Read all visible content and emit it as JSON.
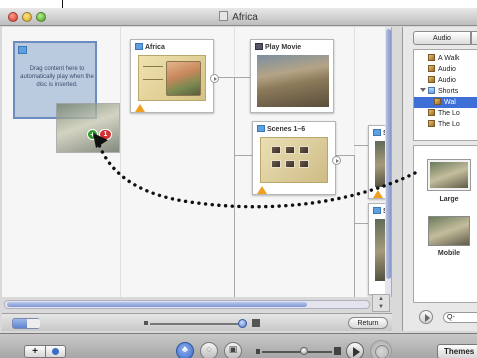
{
  "window": {
    "title": "Africa"
  },
  "canvas": {
    "dropzone_hint": "Drag content here to automatically play when the disc is inserted.",
    "drag_badge_count": "1",
    "nodes": {
      "africa": {
        "title": "Africa"
      },
      "play_movie": {
        "title": "Play Movie"
      },
      "scenes": {
        "title": "Scenes 1–6"
      },
      "side_a": {
        "title": "Sc"
      },
      "side_b": {
        "title": "Sc"
      }
    },
    "return_label": "Return"
  },
  "panel": {
    "tabs": [
      {
        "label": "Audio"
      },
      {
        "label": ""
      }
    ],
    "media": [
      {
        "label": "A Walk",
        "kind": "file"
      },
      {
        "label": "Audio",
        "kind": "file"
      },
      {
        "label": "Audio",
        "kind": "file"
      },
      {
        "label": "Shorts",
        "kind": "folder"
      },
      {
        "label": "Wal",
        "kind": "file",
        "selected": true
      },
      {
        "label": "The Lo",
        "kind": "file"
      },
      {
        "label": "The Lo",
        "kind": "file"
      }
    ],
    "styles": [
      {
        "label": "Large"
      },
      {
        "label": "Mobile"
      }
    ],
    "search_placeholder": "Q-"
  },
  "toolbar": {
    "add_label": "+",
    "themes_label": "Themes"
  },
  "colors": {
    "selection": "#3d6fd6",
    "add_badge": "#2a9a2a",
    "count_badge": "#d63030",
    "scroll_accent": "#7f96d4"
  },
  "icons": [
    "doc-icon",
    "plus-icon",
    "info-icon",
    "play-icon",
    "search-icon",
    "warning-icon",
    "folder-icon",
    "audio-file-icon",
    "zoom-small-icon",
    "zoom-large-icon",
    "volume-low-icon",
    "volume-high-icon",
    "burn-icon"
  ]
}
